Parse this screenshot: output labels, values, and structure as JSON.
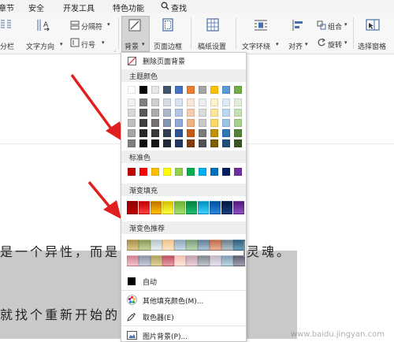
{
  "menubar": {
    "items": [
      "章节",
      "安全",
      "开发工具",
      "特色功能",
      "查找"
    ]
  },
  "ribbon": {
    "fenlan": "分栏",
    "wenzi_fangxiang": "文字方向",
    "fenge_fu": "分隔符",
    "hanghao": "行号",
    "beijing": "背景",
    "yemian_biankuang": "页面边框",
    "gaozhi_shezhi": "稿纸设置",
    "wenzi_huanrao": "文字环绕",
    "duiqi": "对齐",
    "zuhe": "组合",
    "xuanzhuan": "旋转",
    "xuanze_chuangge": "选择窗格"
  },
  "document": {
    "line1": "是一个异性，而是",
    "line1_right": "灵魂。",
    "line2": "就找个重新开始的"
  },
  "dropdown": {
    "delete_bg": "删除页面背景",
    "theme_colors_head": "主题颜色",
    "standard_head": "标准色",
    "gradient_head": "渐变填充",
    "recommended_head": "渐变色推荐",
    "auto": "自动",
    "more_colors": "其他填充颜色(M)...",
    "picker": "取色器(E)",
    "picture_bg": "图片背景(P)...",
    "theme_base": [
      "#ffffff",
      "#000000",
      "#e7e6e6",
      "#44546a",
      "#4472c4",
      "#ed7d31",
      "#a5a5a5",
      "#ffc000",
      "#5b9bd5",
      "#70ad47"
    ],
    "theme_shades": [
      [
        "#f2f2f2",
        "#7f7f7f",
        "#d0cece",
        "#d6dce4",
        "#d9e2f3",
        "#fbe5d5",
        "#ededed",
        "#fff2cc",
        "#deebf6",
        "#e2efd9"
      ],
      [
        "#d8d8d8",
        "#595959",
        "#aeabab",
        "#adb9ca",
        "#b4c6e7",
        "#f7cbac",
        "#dbdbdb",
        "#fee599",
        "#bdd7ee",
        "#c5e0b3"
      ],
      [
        "#bfbfbf",
        "#3f3f3f",
        "#757070",
        "#8496b0",
        "#8eaadb",
        "#f4b183",
        "#c9c9c9",
        "#ffd965",
        "#9dc3e6",
        "#a8d08d"
      ],
      [
        "#a5a5a5",
        "#262626",
        "#3a3838",
        "#323f4f",
        "#2f5496",
        "#c55a11",
        "#7b7b7b",
        "#bf9000",
        "#2e75b5",
        "#538135"
      ],
      [
        "#7f7f7f",
        "#0c0c0c",
        "#171616",
        "#222a35",
        "#1f3864",
        "#833c0b",
        "#525252",
        "#7f6000",
        "#1e4e79",
        "#375623"
      ]
    ],
    "standard": [
      "#c00000",
      "#ff0000",
      "#ffc000",
      "#ffff00",
      "#92d050",
      "#00b050",
      "#00b0f0",
      "#0070c0",
      "#002060",
      "#7030a0"
    ],
    "gradient": [
      [
        "#8b0000",
        "#c00000"
      ],
      [
        "#c00000",
        "#ff4040"
      ],
      [
        "#c07000",
        "#ffc000"
      ],
      [
        "#d8c000",
        "#ffff40"
      ],
      [
        "#70b030",
        "#a0e070"
      ],
      [
        "#008040",
        "#20c070"
      ],
      [
        "#0090c0",
        "#40d0ff"
      ],
      [
        "#004f9f",
        "#2a8ae0"
      ],
      [
        "#001840",
        "#1a3f80"
      ],
      [
        "#501880",
        "#9050c0"
      ]
    ],
    "recommended_row1": [
      [
        "#a8904a",
        "#e0c988"
      ],
      [
        "#8a9a5a",
        "#c9d59a"
      ],
      [
        "#b6c7c9",
        "#e8eeee"
      ],
      [
        "#f2c48c",
        "#fbe7c5"
      ],
      [
        "#8da8bf",
        "#c9d9e6"
      ],
      [
        "#7a9f7a",
        "#bad4b0"
      ],
      [
        "#5f7f99",
        "#aec4d6"
      ],
      [
        "#bf6a4a",
        "#e9b49b"
      ],
      [
        "#6b7e8a",
        "#b5c3cc"
      ],
      [
        "#2f5f7f",
        "#6c9fbf"
      ]
    ],
    "recommended_row2": [
      [
        "#d08090",
        "#f5c4cc"
      ],
      [
        "#8f96a8",
        "#c8ccd8"
      ],
      [
        "#b0a060",
        "#e0d39a"
      ],
      [
        "#c05060",
        "#e8a0a8"
      ],
      [
        "#f4c0b0",
        "#fde6dc"
      ],
      [
        "#c8a0b0",
        "#ead2dc"
      ],
      [
        "#808890",
        "#c0c6cc"
      ],
      [
        "#c0b8c8",
        "#e8e2ee"
      ],
      [
        "#7fa0b8",
        "#c0d4e0"
      ],
      [
        "#5f5f6f",
        "#a0a0b0"
      ]
    ]
  },
  "watermark": "www.baidu.jingyan.com"
}
